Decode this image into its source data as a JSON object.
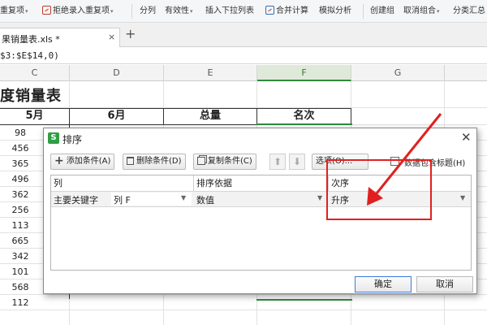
{
  "ribbon": {
    "items": [
      {
        "label": "重复项",
        "caret": "▾"
      },
      {
        "label": "拒绝录入重复项",
        "caret": "▾"
      },
      {
        "label": "分列"
      },
      {
        "label": "有效性",
        "caret": "▾"
      },
      {
        "label": "插入下拉列表"
      },
      {
        "label": "合并计算"
      },
      {
        "label": "模拟分析"
      },
      {
        "label": "创建组"
      },
      {
        "label": "取消组合",
        "caret": "▾"
      },
      {
        "label": "分类汇总"
      }
    ]
  },
  "tabs": {
    "file_name": "果销量表.xls *",
    "close": "×",
    "add": "+"
  },
  "formula": {
    "text": "$3:$E$14,0)"
  },
  "columns": [
    "C",
    "D",
    "E",
    "F",
    "G"
  ],
  "sheet": {
    "title": "度销量表",
    "headers": [
      "5月",
      "6月",
      "总量",
      "名次"
    ],
    "may_values": [
      "98",
      "456",
      "365",
      "496",
      "362",
      "256",
      "113",
      "665",
      "342",
      "101",
      "568",
      "112"
    ]
  },
  "dialog": {
    "title": "排序",
    "logo": "S",
    "close": "✕",
    "add_condition": "添加条件(A)",
    "delete_condition": "删除条件(D)",
    "copy_condition": "复制条件(C)",
    "up": "⬆",
    "down": "⬇",
    "options": "选项(O)...",
    "has_header_label": "数据包含标题(H)",
    "col_header": "列",
    "basis_header": "排序依据",
    "order_header": "次序",
    "row": {
      "key_label": "主要关键字",
      "column": "列 F",
      "basis": "数值",
      "order": "升序"
    },
    "ok": "确定",
    "cancel": "取消"
  },
  "colors": {
    "accent_green": "#2e8b3e",
    "annotation_red": "#e02020"
  }
}
